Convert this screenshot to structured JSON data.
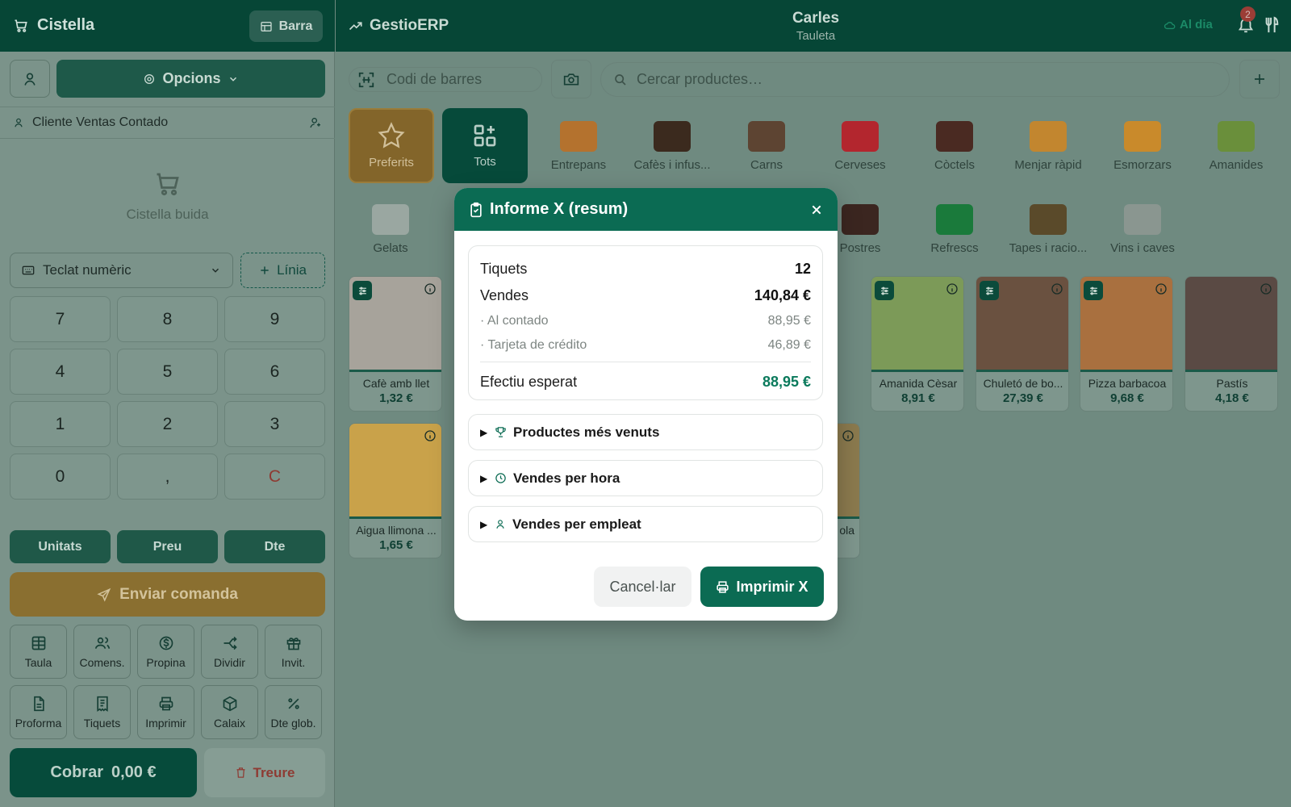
{
  "cart": {
    "title": "Cistella",
    "barra_label": "Barra",
    "opcions_label": "Opcions",
    "client": "Cliente Ventas Contado",
    "empty_label": "Cistella buida",
    "keypad_mode": "Teclat numèric",
    "add_line_label": "Línia",
    "keys": [
      "7",
      "8",
      "9",
      "4",
      "5",
      "6",
      "1",
      "2",
      "3",
      "0",
      ",",
      "C"
    ],
    "modes": [
      "Unitats",
      "Preu",
      "Dte"
    ],
    "send_label": "Enviar comanda",
    "tools": [
      {
        "label": "Taula",
        "icon": "table-icon"
      },
      {
        "label": "Comens.",
        "icon": "users-icon"
      },
      {
        "label": "Propina",
        "icon": "tip-icon"
      },
      {
        "label": "Dividir",
        "icon": "split-icon"
      },
      {
        "label": "Invit.",
        "icon": "gift-icon"
      },
      {
        "label": "Proforma",
        "icon": "document-icon"
      },
      {
        "label": "Tiquets",
        "icon": "receipt-icon"
      },
      {
        "label": "Imprimir",
        "icon": "printer-icon"
      },
      {
        "label": "Calaix",
        "icon": "box-icon"
      },
      {
        "label": "Dte glob.",
        "icon": "percent-icon"
      }
    ],
    "pay_label": "Cobrar",
    "pay_amount": "0,00 €",
    "remove_label": "Treure"
  },
  "topbar": {
    "brand": "GestioERP",
    "waiter_name": "Carles",
    "waiter_role": "Tauleta",
    "sync_status": "Al dia",
    "notifications": "2"
  },
  "search": {
    "barcode_placeholder": "Codi de barres",
    "product_placeholder": "Cercar productes…"
  },
  "categories": {
    "favorites": "Preferits",
    "all": "Tots",
    "items": [
      {
        "label": "Entrepans",
        "color": "#b4722e"
      },
      {
        "label": "Cafès i infus...",
        "color": "#3b2a1e"
      },
      {
        "label": "Carns",
        "color": "#5d4432"
      },
      {
        "label": "Cerveses",
        "color": "#b3262e"
      },
      {
        "label": "Còctels",
        "color": "#4a2a22"
      },
      {
        "label": "Menjar ràpid",
        "color": "#c2862f"
      },
      {
        "label": "Esmorzars",
        "color": "#c98a2b"
      },
      {
        "label": "Amanides",
        "color": "#6a8f3b"
      },
      {
        "label": "Gelats",
        "color": "#9aa7a1"
      },
      {
        "label": "Postres",
        "color": "#3b2620"
      },
      {
        "label": "Refrescs",
        "color": "#1a7a3b"
      },
      {
        "label": "Tapes i racio...",
        "color": "#5a4a2a"
      },
      {
        "label": "Vins i caves",
        "color": "#8a9690"
      }
    ]
  },
  "products": [
    {
      "name": "Cafè amb llet",
      "price": "1,32 €",
      "color": "#a7a39b"
    },
    {
      "name": "Amanida Cèsar",
      "price": "8,91 €",
      "color": "#7c9a58"
    },
    {
      "name": "Chuletó de bo...",
      "price": "27,39 €",
      "color": "#6a5140"
    },
    {
      "name": "Pizza barbacoa",
      "price": "9,68 €",
      "color": "#a9703f"
    },
    {
      "name": "Pastís",
      "price": "4,18 €",
      "color": "#5a4a44"
    },
    {
      "name": "Aigua llimona ...",
      "price": "1,65 €",
      "color": "#c9a24a"
    },
    {
      "name": "ola",
      "price": "",
      "color": "#8b7a4e"
    }
  ],
  "report": {
    "title": "Informe X (resum)",
    "tickets_label": "Tiquets",
    "tickets_value": "12",
    "sales_label": "Vendes",
    "sales_value": "140,84 €",
    "cash_label": "· Al contado",
    "cash_value": "88,95 €",
    "card_label": "· Tarjeta de crédito",
    "card_value": "46,89 €",
    "expected_label": "Efectiu esperat",
    "expected_value": "88,95 €",
    "sections": [
      "Productes més venuts",
      "Vendes per hora",
      "Vendes per empleat"
    ],
    "cancel_label": "Cancel·lar",
    "print_label": "Imprimir X"
  },
  "colors": {
    "brand_green": "#0b6b53",
    "accent_gold": "#8a6f30",
    "expected_green": "#0b7a5c"
  }
}
